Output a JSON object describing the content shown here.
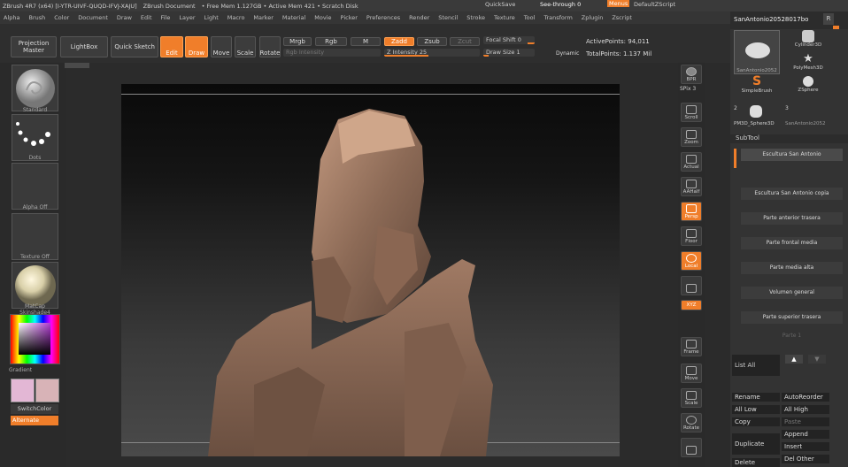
{
  "menubar": {
    "left": [
      "ZBrush 4R7 (x64) [I-YTR-UIVF-QUQD-IFVJ-XAJU]",
      "ZBrush Document",
      "• Free Mem 1.127GB • Active Mem 421 • Scratch Disk"
    ],
    "right": {
      "quicksave": "QuickSave",
      "seethrough": "See-through 0",
      "menus": "Menus",
      "script": "DefaultZScript"
    }
  },
  "menus": [
    "Alpha",
    "Brush",
    "Color",
    "Document",
    "Draw",
    "Edit",
    "File",
    "Layer",
    "Light",
    "Macro",
    "Marker",
    "Material",
    "Movie",
    "Picker",
    "Preferences",
    "Render",
    "Stencil",
    "Stroke",
    "Texture",
    "Tool",
    "Transform",
    "Zplugin",
    "Zscript"
  ],
  "toolbar": {
    "projection": "Projection Master",
    "lightbox": "LightBox",
    "quicksketch": "Quick Sketch",
    "edit": "Edit",
    "draw": "Draw",
    "move": "Move",
    "scale": "Scale",
    "rotate": "Rotate",
    "mrgb": "Mrgb",
    "rgb": "Rgb",
    "m": "M",
    "zadd": "Zadd",
    "zsub": "Zsub",
    "zcut": "Zcut",
    "rgb_intensity": "Rgb Intensity",
    "z_intensity": "Z Intensity 25",
    "focal_shift": "Focal Shift 0",
    "draw_size": "Draw Size 1",
    "dynamic": "Dynamic",
    "active_points": "ActivePoints: 94,011",
    "total_points": "TotalPoints: 1.137 Mil"
  },
  "left": {
    "brush": "Standard",
    "stroke": "Dots",
    "alpha": "Alpha Off",
    "texture": "Texture Off",
    "material": "MatCap Skinshade4",
    "gradient": "Gradient",
    "switchcolor": "SwitchColor",
    "alternate": "Alternate"
  },
  "dock": [
    "BPR",
    "SPix 3",
    "Scroll",
    "Zoom",
    "Actual",
    "AAHalf",
    "Persp",
    "Floor",
    "Local",
    "XYZ",
    "Frame",
    "Move",
    "Scale",
    "Rotate",
    "Line Fill PolyF"
  ],
  "tool": {
    "name": "SanAntonio20528017bo",
    "r": "R",
    "items": [
      "SanAntonio2052",
      "Cylinder3D",
      "PolyMesh3D",
      "SimpleBrush",
      "ZSphere",
      "PM3D_Sphere3D",
      "SanAntonio2052"
    ],
    "count": "2",
    "count2": "3"
  },
  "subtool": {
    "title": "SubTool",
    "items": [
      "Escultura San Antonio",
      "Escultura San Antonio copia",
      "Parte anterior trasera",
      "Parte frontal media",
      "Parte media alta",
      "Volumen general",
      "Parte superior trasera",
      "Parte 1"
    ],
    "listall": "List All",
    "actions": [
      [
        "Rename",
        "AutoReorder"
      ],
      [
        "All Low",
        "All High"
      ],
      [
        "Copy",
        "Paste"
      ],
      [
        "Duplicate",
        "Append"
      ],
      [
        "",
        "Insert"
      ],
      [
        "Delete",
        "Del Other"
      ]
    ]
  },
  "colors": {
    "accent": "#f07e2a",
    "sculpt": "#8a6a55"
  }
}
